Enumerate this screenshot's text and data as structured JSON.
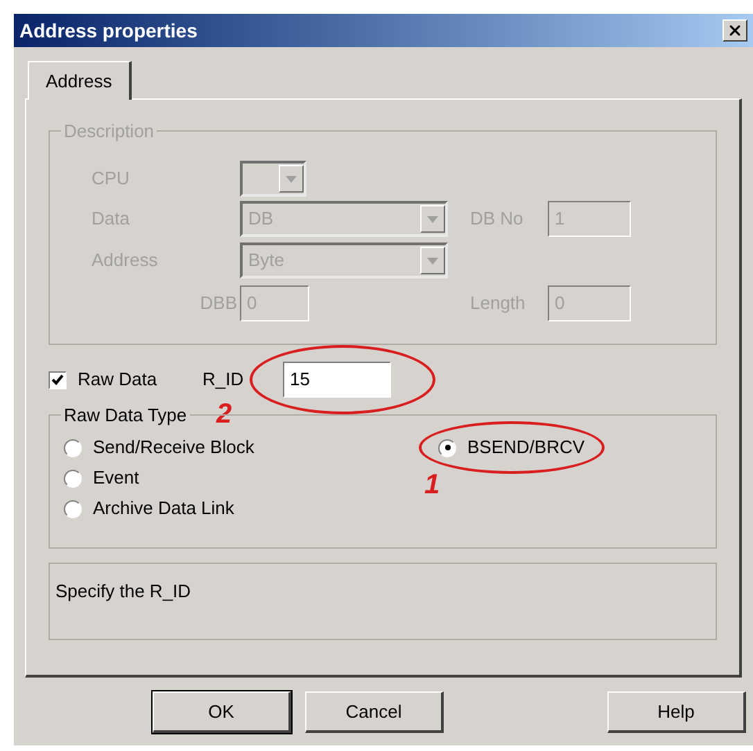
{
  "window": {
    "title": "Address properties"
  },
  "tabs": [
    {
      "label": "Address",
      "selected": true
    }
  ],
  "description": {
    "title": "Description",
    "disabled": true,
    "cpu": {
      "label": "CPU"
    },
    "data": {
      "label": "Data",
      "value": "DB"
    },
    "db_no": {
      "label": "DB No",
      "value": "1"
    },
    "address": {
      "label": "Address",
      "value": "Byte"
    },
    "dbb": {
      "label": "DBB",
      "value": "0"
    },
    "length": {
      "label": "Length",
      "value": "0"
    }
  },
  "raw_data": {
    "label": "Raw Data",
    "checked": true
  },
  "r_id": {
    "label": "R_ID",
    "value": "15",
    "highlighted": true,
    "marker": "2"
  },
  "raw_data_type": {
    "title": "Raw Data Type",
    "options": [
      {
        "label": "Send/Receive Block",
        "selected": false,
        "highlighted": false
      },
      {
        "label": "Event",
        "selected": false,
        "highlighted": false
      },
      {
        "label": "Archive Data Link",
        "selected": false,
        "highlighted": false
      },
      {
        "label": "BSEND/BRCV",
        "selected": true,
        "highlighted": true,
        "marker": "1"
      }
    ]
  },
  "info": {
    "text": "Specify the R_ID"
  },
  "buttons": [
    {
      "label": "OK",
      "default": true
    },
    {
      "label": "Cancel",
      "default": false
    },
    {
      "label": "Help",
      "default": false
    }
  ]
}
